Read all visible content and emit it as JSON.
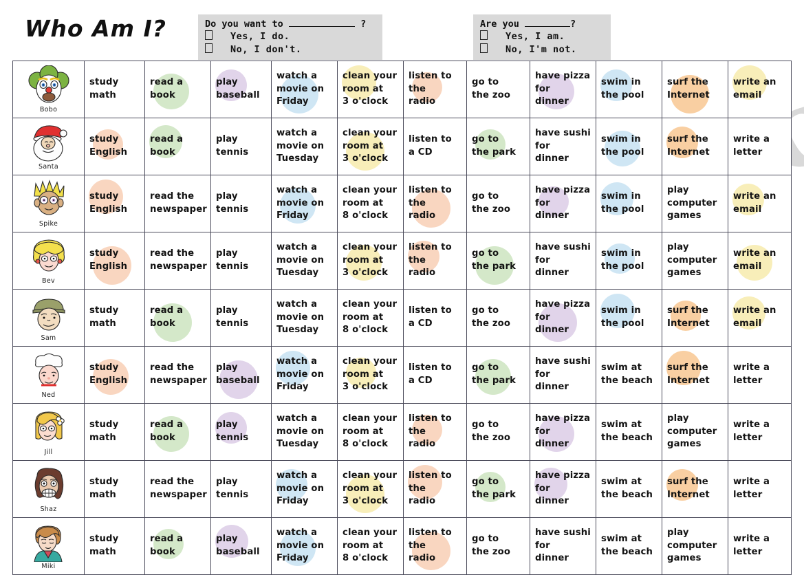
{
  "title": "Who Am I?",
  "question_boxes": [
    {
      "id": "want",
      "prompt_before": "Do you want to",
      "prompt_after": "?",
      "yes": "Yes, I do.",
      "no": "No, I don't."
    },
    {
      "id": "are",
      "prompt_before": "Are you",
      "prompt_after": "?",
      "yes": "Yes, I am.",
      "no": "No, I'm not."
    }
  ],
  "watermark": "eslprintables.com",
  "colors": {
    "peach": "#f7c6a8",
    "green": "#c3dfb4",
    "purple": "#d6c3e2",
    "blue": "#bddcf0",
    "yellow": "#f5e79e",
    "orange": "#f6bc7e",
    "box_bg": "#d9d9d9",
    "border": "#4a4a5a"
  },
  "columns": [
    "face",
    "study",
    "read",
    "play",
    "watch",
    "clean",
    "listen",
    "go",
    "have",
    "swim",
    "internet_games",
    "write"
  ],
  "rows": [
    {
      "name": "Bobo",
      "face": "clown",
      "cells": [
        {
          "text": "study\nmath",
          "blob": null
        },
        {
          "text": "read a\nbook",
          "blob": "green"
        },
        {
          "text": "play\nbaseball",
          "blob": "purple"
        },
        {
          "text": "watch a\nmovie on\nFriday",
          "blob": "blue"
        },
        {
          "text": "clean your\nroom at\n3 o'clock",
          "blob": "yellow"
        },
        {
          "text": "listen to\nthe\nradio",
          "blob": "peach"
        },
        {
          "text": "go to\nthe zoo",
          "blob": null
        },
        {
          "text": "have pizza\nfor\ndinner",
          "blob": "purple"
        },
        {
          "text": "swim in\nthe pool",
          "blob": "blue"
        },
        {
          "text": "surf the\nInternet",
          "blob": "orange"
        },
        {
          "text": "write an\nemail",
          "blob": "yellow"
        }
      ]
    },
    {
      "name": "Santa",
      "face": "santa",
      "cells": [
        {
          "text": "study\nEnglish",
          "blob": "peach"
        },
        {
          "text": "read a\nbook",
          "blob": "green"
        },
        {
          "text": "play\ntennis",
          "blob": null
        },
        {
          "text": "watch a\nmovie on\nTuesday",
          "blob": null
        },
        {
          "text": "clean your\nroom at\n3 o'clock",
          "blob": "yellow"
        },
        {
          "text": "listen to\na CD",
          "blob": null
        },
        {
          "text": "go to\nthe park",
          "blob": "green"
        },
        {
          "text": "have sushi\nfor\ndinner",
          "blob": null
        },
        {
          "text": "swim in\nthe pool",
          "blob": "blue"
        },
        {
          "text": "surf the\nInternet",
          "blob": "orange"
        },
        {
          "text": "write a\nletter",
          "blob": null
        }
      ]
    },
    {
      "name": "Spike",
      "face": "spike",
      "cells": [
        {
          "text": "study\nEnglish",
          "blob": "peach"
        },
        {
          "text": "read the\nnewspaper",
          "blob": null
        },
        {
          "text": "play\ntennis",
          "blob": null
        },
        {
          "text": "watch a\nmovie on\nFriday",
          "blob": "blue"
        },
        {
          "text": "clean your\nroom at\n8 o'clock",
          "blob": null
        },
        {
          "text": "listen to\nthe\nradio",
          "blob": "peach"
        },
        {
          "text": "go to\nthe zoo",
          "blob": null
        },
        {
          "text": "have pizza\nfor\ndinner",
          "blob": "purple"
        },
        {
          "text": "swim in\nthe pool",
          "blob": "blue"
        },
        {
          "text": "play\ncomputer\ngames",
          "blob": null
        },
        {
          "text": "write an\nemail",
          "blob": "yellow"
        }
      ]
    },
    {
      "name": "Bev",
      "face": "bev",
      "cells": [
        {
          "text": "study\nEnglish",
          "blob": "peach"
        },
        {
          "text": "read the\nnewspaper",
          "blob": null
        },
        {
          "text": "play\ntennis",
          "blob": null
        },
        {
          "text": "watch a\nmovie on\nTuesday",
          "blob": null
        },
        {
          "text": "clean your\nroom at\n3 o'clock",
          "blob": "yellow"
        },
        {
          "text": "listen to\nthe\nradio",
          "blob": "peach"
        },
        {
          "text": "go to\nthe park",
          "blob": "green"
        },
        {
          "text": "have sushi\nfor\ndinner",
          "blob": null
        },
        {
          "text": "swim in\nthe pool",
          "blob": "blue"
        },
        {
          "text": "play\ncomputer\ngames",
          "blob": null
        },
        {
          "text": "write an\nemail",
          "blob": "yellow"
        }
      ]
    },
    {
      "name": "Sam",
      "face": "sam",
      "cells": [
        {
          "text": "study\nmath",
          "blob": null
        },
        {
          "text": "read a\nbook",
          "blob": "green"
        },
        {
          "text": "play\ntennis",
          "blob": null
        },
        {
          "text": "watch a\nmovie on\nTuesday",
          "blob": null
        },
        {
          "text": "clean your\nroom at\n8 o'clock",
          "blob": null
        },
        {
          "text": "listen to\na CD",
          "blob": null
        },
        {
          "text": "go to\nthe zoo",
          "blob": null
        },
        {
          "text": "have pizza\nfor\ndinner",
          "blob": "purple"
        },
        {
          "text": "swim in\nthe pool",
          "blob": "blue"
        },
        {
          "text": "surf the\nInternet",
          "blob": "orange"
        },
        {
          "text": "write an\nemail",
          "blob": "yellow"
        }
      ]
    },
    {
      "name": "Ned",
      "face": "ned",
      "cells": [
        {
          "text": "study\nEnglish",
          "blob": "peach"
        },
        {
          "text": "read the\nnewspaper",
          "blob": null
        },
        {
          "text": "play\nbaseball",
          "blob": "purple"
        },
        {
          "text": "watch a\nmovie on\nFriday",
          "blob": "blue"
        },
        {
          "text": "clean your\nroom at\n3 o'clock",
          "blob": "yellow"
        },
        {
          "text": "listen to\na CD",
          "blob": null
        },
        {
          "text": "go to\nthe park",
          "blob": "green"
        },
        {
          "text": "have sushi\nfor\ndinner",
          "blob": null
        },
        {
          "text": "swim at\nthe beach",
          "blob": null
        },
        {
          "text": "surf the\nInternet",
          "blob": "orange"
        },
        {
          "text": "write a\nletter",
          "blob": null
        }
      ]
    },
    {
      "name": "Jill",
      "face": "jill",
      "cells": [
        {
          "text": "study\nmath",
          "blob": null
        },
        {
          "text": "read a\nbook",
          "blob": "green"
        },
        {
          "text": "play\ntennis",
          "blob": "purple"
        },
        {
          "text": "watch a\nmovie on\nTuesday",
          "blob": null
        },
        {
          "text": "clean your\nroom at\n8 o'clock",
          "blob": null
        },
        {
          "text": "listen to\nthe\nradio",
          "blob": "peach"
        },
        {
          "text": "go to\nthe zoo",
          "blob": null
        },
        {
          "text": "have pizza\nfor\ndinner",
          "blob": "purple"
        },
        {
          "text": "swim at\nthe beach",
          "blob": null
        },
        {
          "text": "play\ncomputer\ngames",
          "blob": null
        },
        {
          "text": "write a\nletter",
          "blob": null
        }
      ]
    },
    {
      "name": "Shaz",
      "face": "shaz",
      "cells": [
        {
          "text": "study\nmath",
          "blob": null
        },
        {
          "text": "read the\nnewspaper",
          "blob": null
        },
        {
          "text": "play\ntennis",
          "blob": null
        },
        {
          "text": "watch a\nmovie on\nFriday",
          "blob": "blue"
        },
        {
          "text": "clean your\nroom at\n3 o'clock",
          "blob": "yellow"
        },
        {
          "text": "listen to\nthe\nradio",
          "blob": "peach"
        },
        {
          "text": "go to\nthe park",
          "blob": "green"
        },
        {
          "text": "have pizza\nfor\ndinner",
          "blob": "purple"
        },
        {
          "text": "swim at\nthe beach",
          "blob": null
        },
        {
          "text": "surf the\nInternet",
          "blob": "orange"
        },
        {
          "text": "write a\nletter",
          "blob": null
        }
      ]
    },
    {
      "name": "Miki",
      "face": "miki",
      "cells": [
        {
          "text": "study\nmath",
          "blob": null
        },
        {
          "text": "read a\nbook",
          "blob": "green"
        },
        {
          "text": "play\nbaseball",
          "blob": "purple"
        },
        {
          "text": "watch a\nmovie on\nFriday",
          "blob": "blue"
        },
        {
          "text": "clean your\nroom at\n8 o'clock",
          "blob": null
        },
        {
          "text": "listen to\nthe\nradio",
          "blob": "peach"
        },
        {
          "text": "go to\nthe zoo",
          "blob": null
        },
        {
          "text": "have sushi\nfor\ndinner",
          "blob": null
        },
        {
          "text": "swim at\nthe beach",
          "blob": null
        },
        {
          "text": "play\ncomputer\ngames",
          "blob": null
        },
        {
          "text": "write a\nletter",
          "blob": null
        }
      ]
    }
  ]
}
